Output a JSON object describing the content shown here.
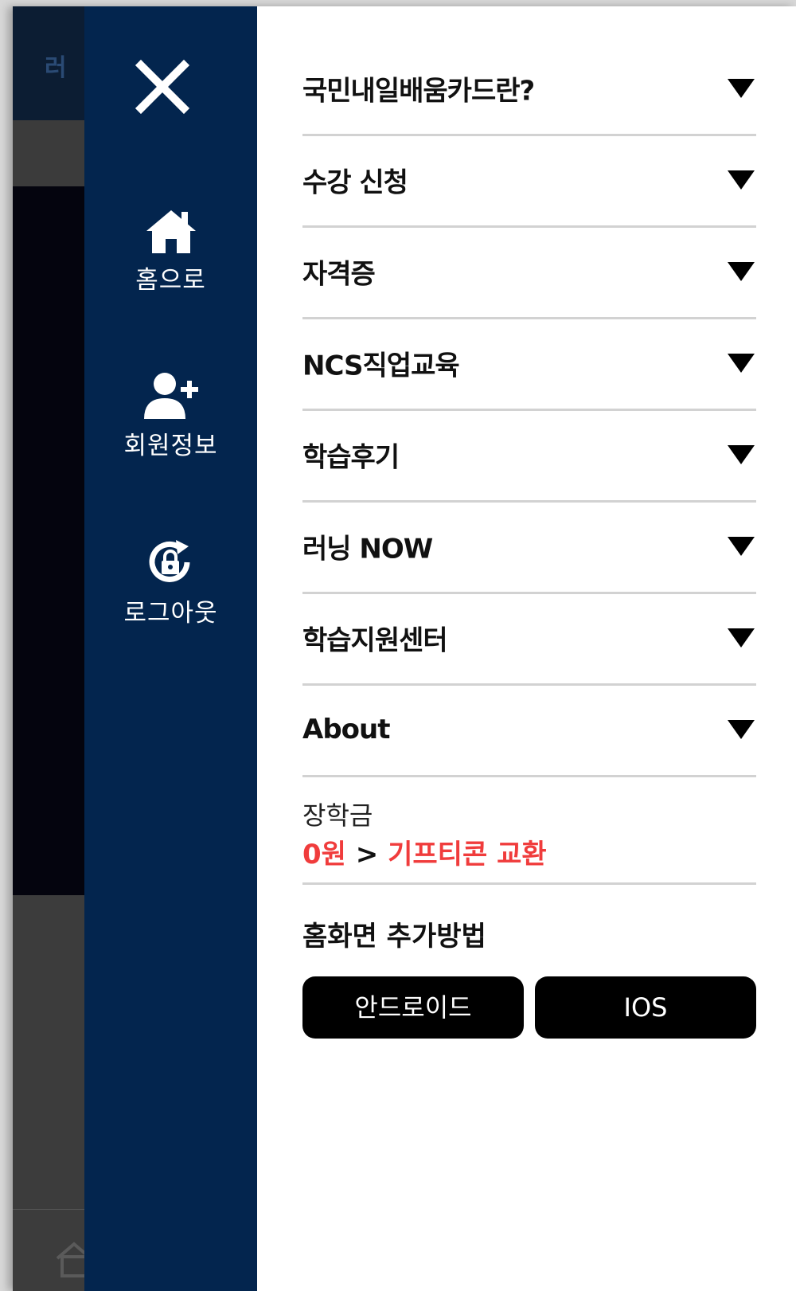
{
  "sidebar": {
    "close_icon": "close-icon",
    "items": [
      {
        "icon": "home-icon",
        "label": "홈으로"
      },
      {
        "icon": "user-add-icon",
        "label": "회원정보"
      },
      {
        "icon": "logout-lock-icon",
        "label": "로그아웃"
      }
    ]
  },
  "menu": {
    "items": [
      {
        "label": "국민내일배움카드란?"
      },
      {
        "label": "수강 신청"
      },
      {
        "label": "자격증"
      },
      {
        "label": "NCS직업교육"
      },
      {
        "label": "학습후기"
      },
      {
        "label": "러닝 NOW"
      },
      {
        "label": "학습지원센터"
      },
      {
        "label": "About"
      }
    ],
    "arrow_icon": "caret-down-icon"
  },
  "scholarship": {
    "title": "장학금",
    "amount": "0원",
    "separator": ">",
    "gift_link": "기프티콘 교환"
  },
  "add_home": {
    "title": "홈화면 추가방법",
    "android_label": "안드로이드",
    "ios_label": "IOS"
  },
  "colors": {
    "sidebar_bg": "#03254e",
    "accent_red": "#f03c3c",
    "button_bg": "#000000"
  }
}
